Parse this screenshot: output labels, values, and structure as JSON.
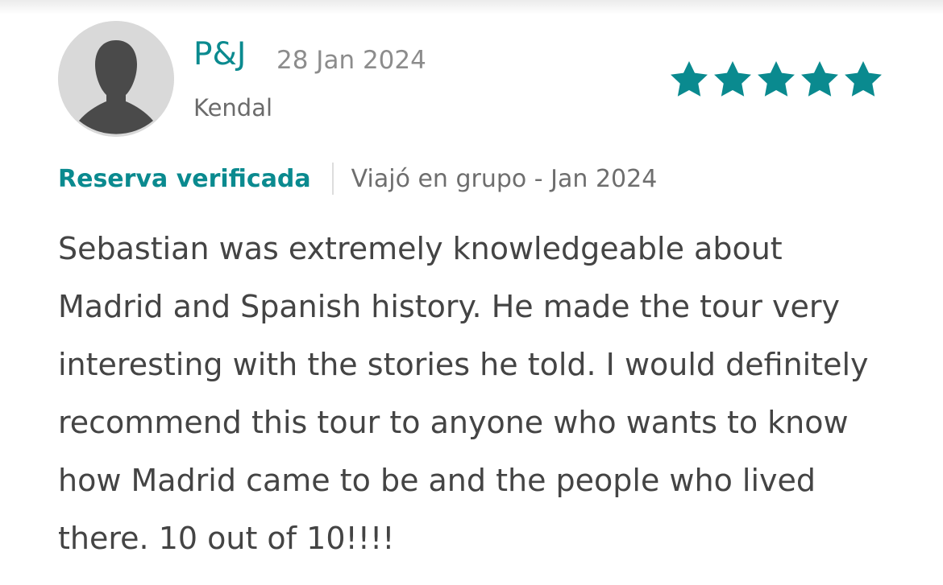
{
  "review": {
    "reviewer_name": "P&J",
    "date": "28 Jan 2024",
    "location": "Kendal",
    "rating": {
      "value": 5,
      "max": 5,
      "color": "#0a8a8f"
    },
    "verified_label": "Reserva verificada",
    "trip_info": "Viajó en grupo - Jan 2024",
    "text": "Sebastian was extremely knowledgeable about Madrid and Spanish history. He made the tour very interesting with the stories he told. I would definitely recommend this tour to anyone who wants to know how Madrid came to be and the people who lived there. 10 out of 10!!!!"
  },
  "icons": {
    "avatar": "default-user-silhouette-icon",
    "star": "star-icon"
  },
  "colors": {
    "accent": "#0a8a8f",
    "text": "#444444",
    "muted": "#8c8c8c"
  }
}
